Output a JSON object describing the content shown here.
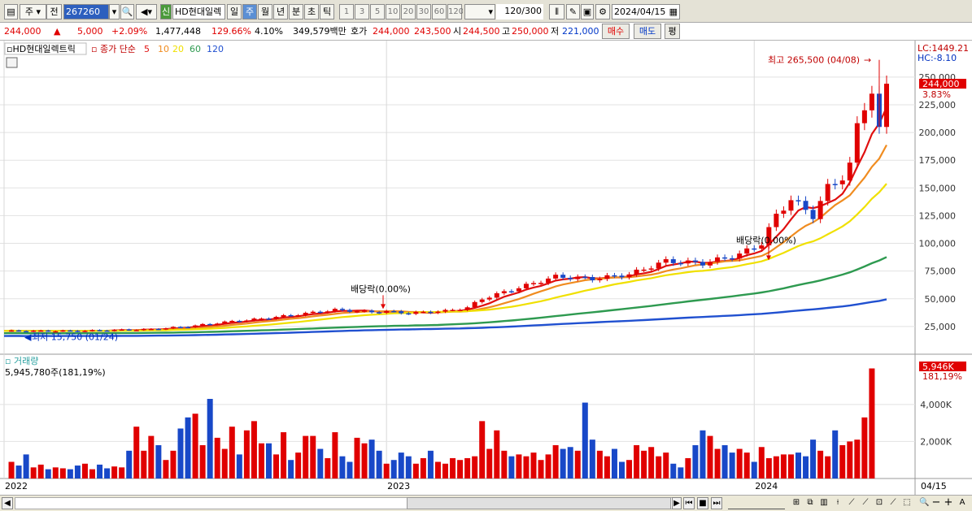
{
  "toolbar": {
    "period_label": "주",
    "prefix_label": "전",
    "code": "267260",
    "stock_name": "HD현대일렉",
    "badge": "신",
    "period_tabs": [
      "일",
      "주",
      "월",
      "년",
      "분",
      "초",
      "틱"
    ],
    "active_period": "주",
    "interval_nums": [
      "1",
      "3",
      "5",
      "10",
      "20",
      "30",
      "60",
      "120"
    ],
    "count_value": "120",
    "count_total": "/300",
    "date_value": "2024/04/15"
  },
  "quote": {
    "price": "244,000",
    "change_arrow": "▲",
    "change": "5,000",
    "change_pct": "+2.09%",
    "volume": "1,477,448",
    "volume_ratio": "129.66%",
    "turnover": "4.10%",
    "amount": "349,579백만",
    "bid_label": "호가",
    "bid": "244,000",
    "ask": "243,500",
    "open_label": "시",
    "open": "244,500",
    "high_label": "고",
    "high": "250,000",
    "low_label": "저",
    "low": "221,000",
    "buy_label": "매수",
    "sell_label": "매도",
    "eval_label": "평"
  },
  "chart_data": {
    "type": "candlestick",
    "title": "HD현대일렉트릭",
    "ma_label": "종가 단순",
    "ma_periods": [
      "5",
      "10",
      "20",
      "60",
      "120"
    ],
    "ma_colors": [
      "#e01010",
      "#f08c20",
      "#f0e000",
      "#2e9a50",
      "#2050d0"
    ],
    "lc": "LC:1449.21",
    "hc": "HC:-8.10",
    "y_ticks": [
      25000,
      50000,
      75000,
      100000,
      125000,
      150000,
      175000,
      200000,
      225000,
      250000
    ],
    "y_tick_labels": [
      "25,000",
      "50,000",
      "75,000",
      "100,000",
      "125,000",
      "150,000",
      "175,000",
      "200,000",
      "225,000",
      "250,000"
    ],
    "y_range": [
      0,
      277000
    ],
    "current_price_label": "244,000",
    "current_pct_label": "3.83%",
    "high_annotation": "최고 265,500 (04/08)",
    "low_annotation": "최저 15,750 (01/24)",
    "dividend_label": "배당락(0.00%)",
    "x_labels": [
      "2022",
      "2023",
      "2024"
    ],
    "last_date": "04/15",
    "volume_title": "거래량",
    "volume_info": "5,945,780주(181,19%)",
    "volume_current": "5,946K",
    "volume_pct": "181,19%",
    "volume_ticks": [
      2000,
      4000
    ],
    "volume_tick_labels": [
      "2,000K",
      "4,000K"
    ],
    "volume_range": [
      0,
      6100
    ],
    "price_anchor_weeks": [
      0,
      10,
      20,
      25,
      30,
      35,
      40,
      45,
      50,
      52,
      55,
      60,
      63,
      65,
      70,
      75,
      80,
      85,
      90,
      95,
      100,
      103,
      105,
      107,
      110,
      112,
      114,
      115,
      116,
      118,
      119,
      120
    ],
    "price_anchor_values": [
      21000,
      21000,
      22500,
      25000,
      29000,
      32000,
      36000,
      40000,
      38000,
      38500,
      37000,
      39000,
      42000,
      50000,
      60000,
      70000,
      68000,
      72000,
      84000,
      82000,
      90000,
      100000,
      125000,
      140000,
      125000,
      150000,
      160000,
      170000,
      205000,
      235000,
      205000,
      244000
    ],
    "volume_values": [
      900,
      700,
      1300,
      600,
      750,
      500,
      600,
      550,
      500,
      700,
      800,
      500,
      750,
      550,
      650,
      600,
      1500,
      2800,
      1500,
      2300,
      1800,
      1000,
      1500,
      2700,
      3300,
      3500,
      1800,
      4300,
      2200,
      1600,
      2800,
      1300,
      2600,
      3100,
      1900,
      1900,
      1300,
      2500,
      1000,
      1400,
      2300,
      2300,
      1600,
      1100,
      2500,
      1200,
      900,
      2200,
      1900,
      2100,
      1500,
      800,
      1000,
      1400,
      1200,
      800,
      1100,
      1500,
      900,
      800,
      1100,
      1000,
      1100,
      1200,
      3100,
      1600,
      2600,
      1500,
      1200,
      1300,
      1200,
      1400,
      1000,
      1300,
      1800,
      1600,
      1700,
      1500,
      4100,
      2100,
      1500,
      1200,
      1600,
      900,
      1000,
      1800,
      1500,
      1700,
      1200,
      1400,
      800,
      600,
      1100,
      1800,
      2600,
      2300,
      1600,
      1800,
      1400,
      1600,
      1400,
      900,
      1700,
      1100,
      1200,
      1300,
      1300,
      1400,
      1200,
      2100,
      1500,
      1200,
      2600,
      1800,
      2000,
      2100,
      3300,
      5946
    ]
  }
}
